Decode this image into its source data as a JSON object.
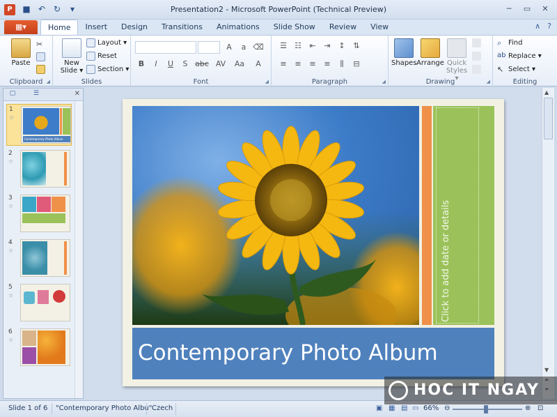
{
  "window": {
    "title": "Presentation2  -  Microsoft PowerPoint (Technical Preview)",
    "app_icon": "powerpoint-icon",
    "qat": [
      {
        "name": "save-icon",
        "glyph": "■"
      },
      {
        "name": "undo-icon",
        "glyph": "↶"
      },
      {
        "name": "redo-icon",
        "glyph": "↻"
      },
      {
        "name": "customize-qat-icon",
        "glyph": "▾"
      }
    ],
    "controls": {
      "minimize": "─",
      "maximize": "▭",
      "close": "✕"
    }
  },
  "ribbon_tabs": {
    "file_label": "▦▾",
    "tabs": [
      "Home",
      "Insert",
      "Design",
      "Transitions",
      "Animations",
      "Slide Show",
      "Review",
      "View"
    ],
    "active": "Home",
    "help": {
      "minimize_ribbon": "∧",
      "help": "?"
    }
  },
  "ribbon": {
    "clipboard": {
      "label": "Clipboard",
      "paste": "Paste"
    },
    "slides": {
      "label": "Slides",
      "new_slide_line1": "New",
      "new_slide_line2": "Slide ▾",
      "layout": "Layout ▾",
      "reset": "Reset",
      "section": "Section ▾"
    },
    "font": {
      "label": "Font",
      "buttons": [
        "B",
        "I",
        "U",
        "S",
        "abc",
        "AV",
        "Aa",
        "A"
      ]
    },
    "paragraph": {
      "label": "Paragraph"
    },
    "drawing": {
      "label": "Drawing",
      "shapes": "Shapes",
      "arrange": "Arrange",
      "quick_styles_line1": "Quick",
      "quick_styles_line2": "Styles ▾"
    },
    "editing": {
      "label": "Editing",
      "find": "Find",
      "replace": "Replace ▾",
      "select": "Select ▾"
    }
  },
  "slides_pane": {
    "thumbnails": [
      {
        "number": "1",
        "selected": true,
        "thumb_text": "Contemporary Photo Album"
      },
      {
        "number": "2",
        "selected": false
      },
      {
        "number": "3",
        "selected": false
      },
      {
        "number": "4",
        "selected": false
      },
      {
        "number": "5",
        "selected": false
      },
      {
        "number": "6",
        "selected": false
      }
    ]
  },
  "slide": {
    "title": "Contemporary Photo Album",
    "side_placeholder": "Click to add date or details",
    "colors": {
      "title_band": "#4f81bd",
      "orange_strip": "#f0914a",
      "green_panel": "#9bc25a",
      "background": "#f2f1e4"
    }
  },
  "status_bar": {
    "slide_info": "Slide 1 of 6",
    "theme": "\"Contemporary Photo Albu\"",
    "language": "Czech",
    "zoom": "66%",
    "zoom_level": 0.66
  },
  "watermark": {
    "text": "HOC IT NGAY"
  }
}
